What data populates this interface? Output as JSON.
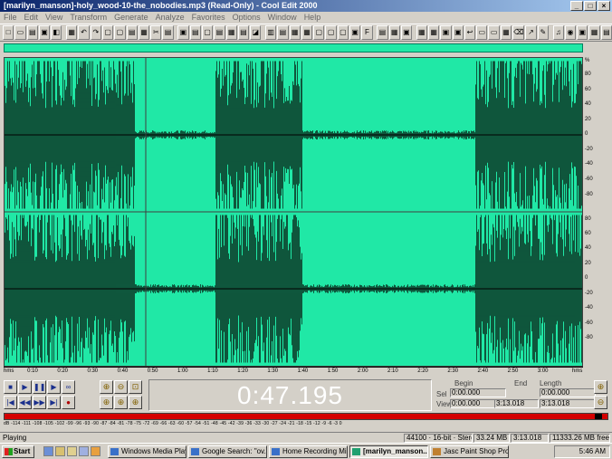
{
  "window": {
    "title": "[marilyn_manson]-holy_wood-10-the_nobodies.mp3 (Read-Only) - Cool Edit 2000"
  },
  "menu": [
    "File",
    "Edit",
    "View",
    "Transform",
    "Generate",
    "Analyze",
    "Favorites",
    "Options",
    "Window",
    "Help"
  ],
  "waveform": {
    "fill_color": "#20e8a6",
    "wave_color": "#0b2a1c",
    "cursor_position": "0:47.195",
    "right_scale_labels": [
      "%",
      "80",
      "60",
      "40",
      "20",
      "0",
      "-20",
      "-40",
      "-60",
      "-80",
      "80",
      "60",
      "40",
      "20",
      "0",
      "-20",
      "-40",
      "-60",
      "-80"
    ]
  },
  "time_ruler": {
    "labels": [
      "hms",
      "0:10",
      "0:20",
      "0:30",
      "0:40",
      "0:50",
      "1:00",
      "1:10",
      "1:20",
      "1:30",
      "1:40",
      "1:50",
      "2:00",
      "2:10",
      "2:20",
      "2:30",
      "2:40",
      "2:50",
      "3:00",
      "hms"
    ]
  },
  "transport": {
    "time_display": "0:47.195"
  },
  "selection": {
    "headers": {
      "begin": "Begin",
      "end": "End",
      "length": "Length"
    },
    "sel": {
      "label": "Sel",
      "begin": "0:00.000",
      "end": "",
      "length": "0:00.000"
    },
    "view": {
      "label": "View",
      "begin": "0:00.000",
      "end": "3:13.018",
      "length": "3:13.018"
    }
  },
  "level_meter": {
    "scale": "dB  -114 -111 -108 -105 -102 -99 -96 -93 -90 -87 -84 -81 -78 -75 -72 -69 -66 -63 -60 -57 -54 -51 -48 -45 -42 -39 -36 -33 -30 -27 -24 -21 -18 -15 -12 -9 -6 -3 0",
    "bar_color": "#d40000"
  },
  "status": {
    "state": "Playing",
    "format": "44100 · 16-bit · Stereo",
    "size": "33.24 MB",
    "duration": "3:13.018",
    "free": "11333.26 MB free"
  },
  "taskbar": {
    "start": "Start",
    "tasks": [
      {
        "label": "Windows Media Player",
        "active": false
      },
      {
        "label": "Google Search: \"ov...",
        "active": false
      },
      {
        "label": "Home Recording Mix...",
        "active": false
      },
      {
        "label": "[marilyn_manson...",
        "active": true
      },
      {
        "label": "Jasc Paint Shop Pro",
        "active": false
      }
    ],
    "clock": "5:46 AM"
  }
}
